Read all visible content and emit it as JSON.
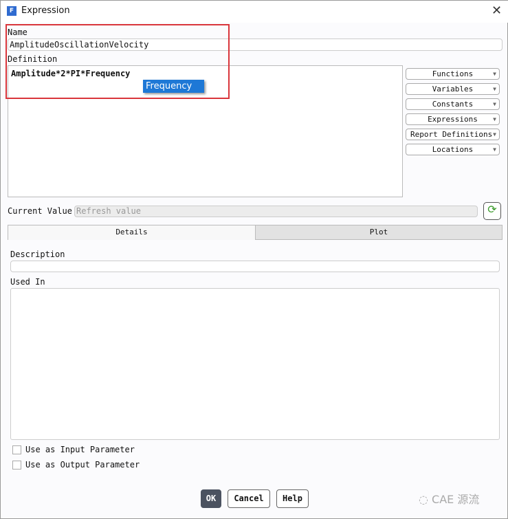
{
  "window": {
    "title": "Expression",
    "icon_letter": "F"
  },
  "name": {
    "label": "Name",
    "value": "AmplitudeOscillationVelocity"
  },
  "definition": {
    "label": "Definition",
    "value": "Amplitude*2*PI*Frequency",
    "autocomplete": "Frequency"
  },
  "dropdowns": [
    "Functions",
    "Variables",
    "Constants",
    "Expressions",
    "Report Definitions",
    "Locations"
  ],
  "current_value": {
    "label": "Current Value",
    "placeholder": "Refresh value"
  },
  "tabs": {
    "details": "Details",
    "plot": "Plot"
  },
  "details": {
    "description_label": "Description",
    "used_in_label": "Used In",
    "input_param": "Use as Input Parameter",
    "output_param": "Use as Output Parameter"
  },
  "buttons": {
    "ok": "OK",
    "cancel": "Cancel",
    "help": "Help"
  },
  "watermark": "CAE 源流"
}
